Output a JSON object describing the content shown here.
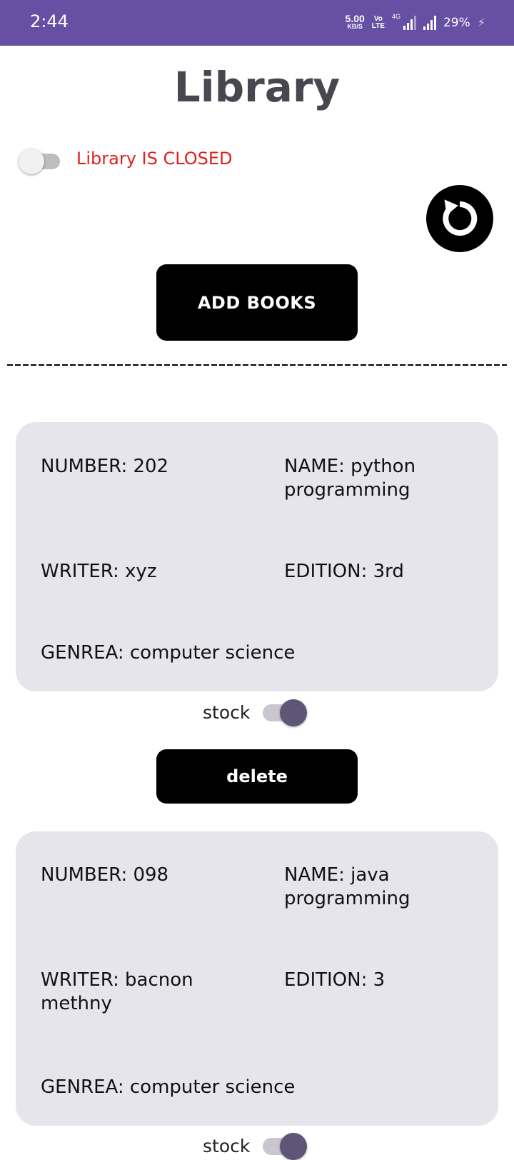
{
  "status_bar": {
    "time": "2:44",
    "net_speed_value": "5.00",
    "net_speed_unit": "KB/S",
    "volte_top": "Vo",
    "volte_bottom": "LTE",
    "network_type": "4G",
    "battery": "29%",
    "color": "#6750a4"
  },
  "header": {
    "title": "Library"
  },
  "library_status": {
    "label": "Library IS CLOSED",
    "toggle_on": false,
    "color": "#e02020"
  },
  "refresh_button": {
    "icon": "refresh-icon"
  },
  "add_books_button": {
    "label": "ADD BOOKS"
  },
  "divider": "-----------------------------------------------------------------------",
  "books": [
    {
      "number": "NUMBER: 202",
      "name": "NAME: python programming",
      "writer": "WRITER: xyz",
      "edition": "EDITION: 3rd",
      "genre": "GENREA: computer science",
      "stock_label": "stock",
      "in_stock": true
    },
    {
      "number": "NUMBER: 098",
      "name": "NAME: java programming",
      "writer": "WRITER: bacnon methny",
      "edition": "EDITION: 3",
      "genre": "GENREA: computer science",
      "stock_label": "stock",
      "in_stock": true
    }
  ],
  "delete_button": {
    "label": "delete"
  }
}
